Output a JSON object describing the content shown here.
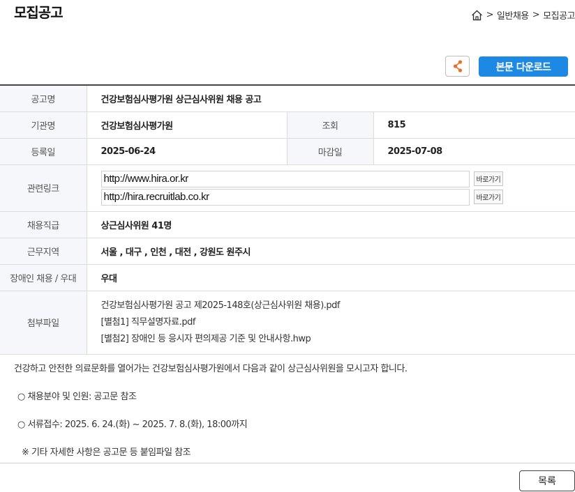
{
  "header": {
    "title": "모집공고",
    "breadcrumb": [
      "일반채용",
      "모집공고"
    ]
  },
  "actions": {
    "share_icon": "share-icon",
    "download_label": "본문 다운로드",
    "accent_color": "#1e88e5"
  },
  "info": {
    "title_label": "공고명",
    "title_value": "건강보험심사평가원 상근심사위원 채용 공고",
    "org_label": "기관명",
    "org_value": "건강보험심사평가원",
    "views_label": "조회",
    "views_value": "815",
    "reg_label": "등록일",
    "reg_value": "2025-06-24",
    "deadline_label": "마감일",
    "deadline_value": "2025-07-08",
    "links_label": "관련링크",
    "links": [
      {
        "url": "http://www.hira.or.kr",
        "button": "바로가기"
      },
      {
        "url": "http://hira.recruitlab.co.kr",
        "button": "바로가기"
      }
    ],
    "position_label": "채용직급",
    "position_value": "상근심사위원 41명",
    "region_label": "근무지역",
    "region_value": "서울 , 대구 , 인천 , 대전 , 강원도 원주시",
    "disabled_label": "장애인 채용 / 우대",
    "disabled_value": "우대",
    "files_label": "첨부파일",
    "files": [
      "건강보험심사평가원 공고 제2025-148호(상근심사위원 채용).pdf",
      "[별첨1] 직무설명자료.pdf",
      "[별첨2] 장애인 등 응시자 편의제공 기준 및 안내사항.hwp"
    ]
  },
  "body": {
    "intro": "건강하고 안전한 의료문화를 열어가는 건강보험심사평가원에서 다음과 같이 상근심사위원을 모시고자 합니다.",
    "line1": "○ 채용분야 및 인원: 공고문 참조",
    "line2": "○ 서류접수: 2025. 6. 24.(화) ~ 2025. 7. 8.(화), 18:00까지",
    "line3": "※ 기타 자세한 사항은 공고문 등 붙임파일 참조"
  },
  "footer": {
    "list_label": "목록"
  }
}
